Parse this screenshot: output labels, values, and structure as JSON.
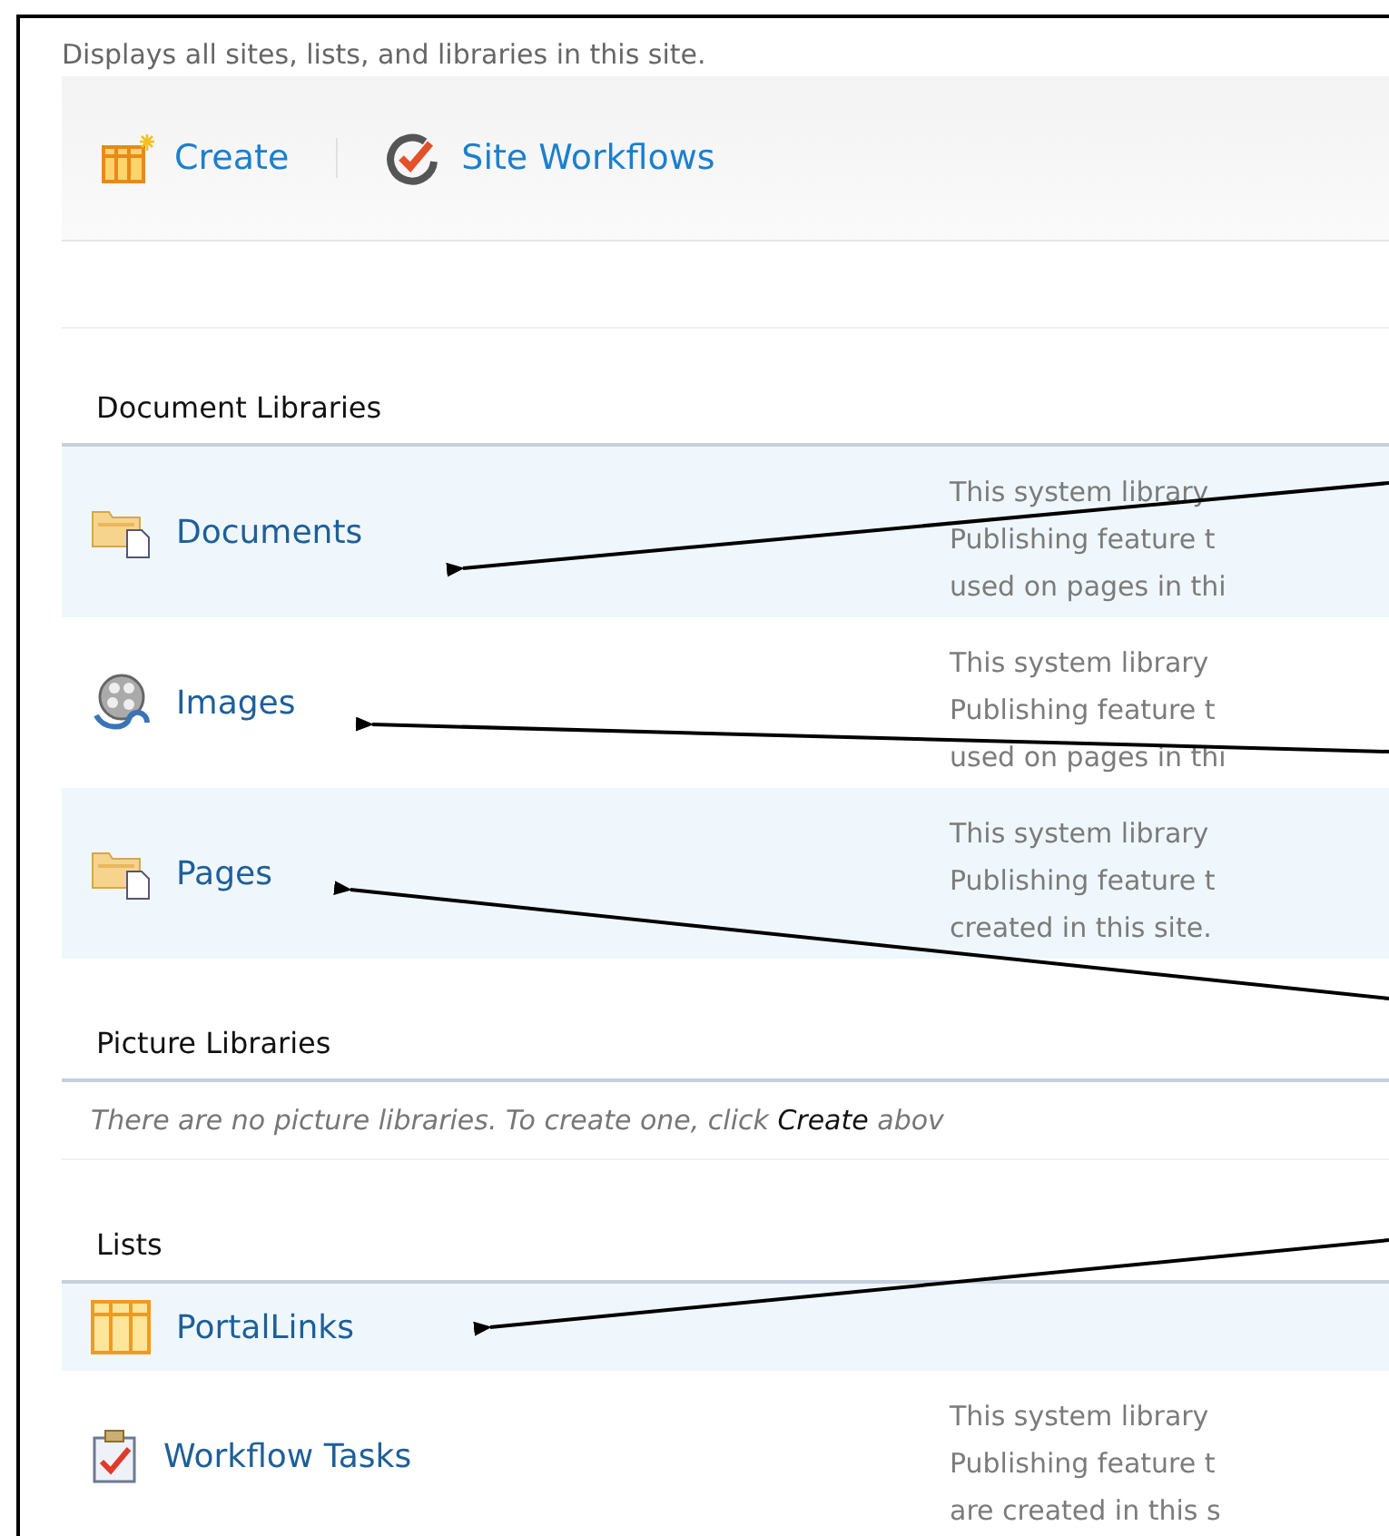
{
  "description": "Displays all sites, lists, and libraries in this site.",
  "toolbar": [
    {
      "label": "Create",
      "kind": "create"
    },
    {
      "label": "Site Workflows",
      "kind": "workflow"
    }
  ],
  "sections": [
    {
      "title": "Document Libraries",
      "items": [
        {
          "name": "Documents",
          "kind": "library",
          "description_lines": [
            "This system library",
            "Publishing feature t",
            "used on pages in thi"
          ]
        },
        {
          "name": "Images",
          "kind": "images",
          "description_lines": [
            "This system library",
            "Publishing feature t",
            "used on pages in thi"
          ]
        },
        {
          "name": "Pages",
          "kind": "library",
          "description_lines": [
            "This system library",
            "Publishing feature t",
            "created in this site."
          ]
        }
      ]
    },
    {
      "title": "Picture Libraries",
      "empty_message": "There are no picture libraries. To create one, click **Create** abov"
    },
    {
      "title": "Lists",
      "items": [
        {
          "name": "PortalLinks",
          "kind": "list"
        },
        {
          "name": "Workflow Tasks",
          "kind": "tasks",
          "description_lines": [
            "This system library",
            "Publishing feature t",
            "are created in this s"
          ]
        }
      ]
    }
  ]
}
